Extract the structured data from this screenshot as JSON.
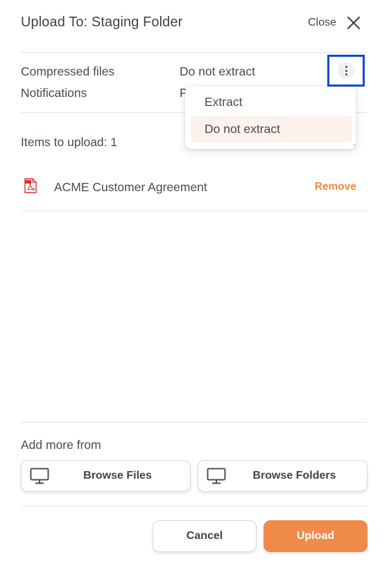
{
  "header": {
    "title": "Upload To: Staging Folder",
    "close_label": "Close"
  },
  "options": {
    "compressed_label": "Compressed files",
    "compressed_value": "Do not extract",
    "notifications_label": "Notifications",
    "notifications_value_partial": "P"
  },
  "dropdown": {
    "items": [
      "Extract",
      "Do not extract"
    ],
    "selected": "Do not extract"
  },
  "items": {
    "count_label": "Items to upload: 1",
    "trailing_glyph": "."
  },
  "files": [
    {
      "name": "ACME Customer Agreement",
      "type_icon": "pdf-icon",
      "remove_label": "Remove"
    }
  ],
  "add_more": {
    "label": "Add more from",
    "browse_files": "Browse Files",
    "browse_folders": "Browse Folders"
  },
  "footer": {
    "cancel": "Cancel",
    "upload": "Upload"
  },
  "colors": {
    "accent": "#ef8a4a",
    "focus_outline": "#0a49d6",
    "selected_bg": "#fdf3ec",
    "pdf_red": "#d5332a"
  }
}
